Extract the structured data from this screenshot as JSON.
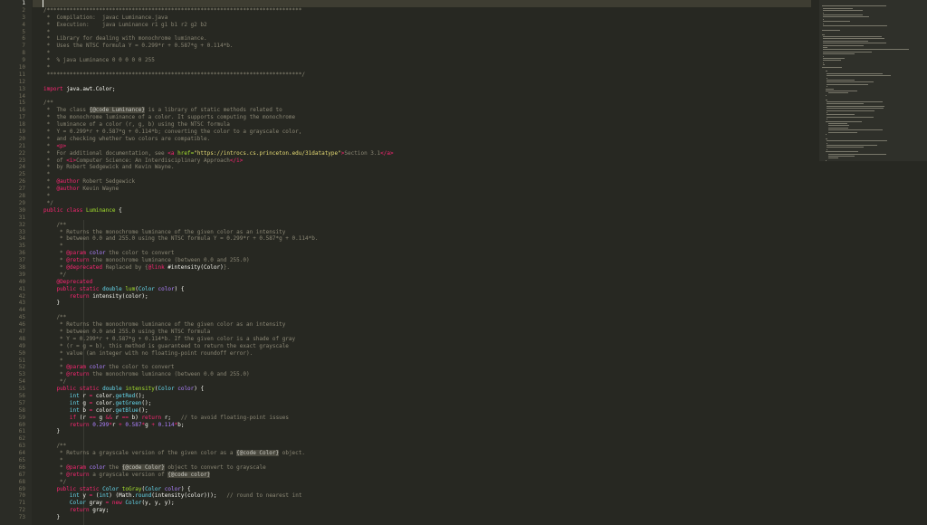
{
  "editor": {
    "current_line": 1,
    "line_numbers": [
      "1",
      "2",
      "3",
      "4",
      "5",
      "6",
      "7",
      "8",
      "9",
      "10",
      "11",
      "12",
      "13",
      "14",
      "15",
      "16",
      "17",
      "18",
      "19",
      "20",
      "21",
      "22",
      "23",
      "24",
      "25",
      "26",
      "27",
      "28",
      "29",
      "30",
      "31",
      "32",
      "33",
      "34",
      "35",
      "36",
      "37",
      "38",
      "39",
      "40",
      "41",
      "42",
      "43",
      "44",
      "45",
      "46",
      "47",
      "48",
      "49",
      "50",
      "51",
      "52",
      "53",
      "54",
      "55",
      "56",
      "57",
      "58",
      "59",
      "60",
      "61",
      "62",
      "63",
      "64",
      "65",
      "66",
      "67",
      "68",
      "69",
      "70",
      "71",
      "72",
      "73"
    ],
    "lines": [
      [],
      [
        [
          "c",
          "/******************************************************************************"
        ]
      ],
      [
        [
          "c",
          " *  Compilation:  javac Luminance.java"
        ]
      ],
      [
        [
          "c",
          " *  Execution:    java Luminance r1 g1 b1 r2 g2 b2"
        ]
      ],
      [
        [
          "c",
          " *"
        ]
      ],
      [
        [
          "c",
          " *  Library for dealing with monochrome luminance."
        ]
      ],
      [
        [
          "c",
          " *  Uses the NTSC formula Y = 0.299*r + 0.587*g + 0.114*b."
        ]
      ],
      [
        [
          "c",
          " *"
        ]
      ],
      [
        [
          "c",
          " *  % java Luminance 0 0 0 0 0 255"
        ]
      ],
      [
        [
          "c",
          " *"
        ]
      ],
      [
        [
          "c",
          " ******************************************************************************/"
        ]
      ],
      [],
      [
        [
          "k",
          "import"
        ],
        [
          "p",
          " java.awt.Color;"
        ]
      ],
      [],
      [
        [
          "c",
          "/**"
        ]
      ],
      [
        [
          "c",
          " *  The class "
        ],
        [
          "hl",
          "{@code Luminance}"
        ],
        [
          "c",
          " is a library of static methods related to"
        ]
      ],
      [
        [
          "c",
          " *  the monochrome luminance of a color. It supports computing the monochrome"
        ]
      ],
      [
        [
          "c",
          " *  luminance of a color (r, g, b) using the NTSC formula"
        ]
      ],
      [
        [
          "c",
          " *  Y = 0.299*r + 0.587*g + 0.114*b; converting the color to a grayscale color,"
        ]
      ],
      [
        [
          "c",
          " *  and checking whether two colors are compatible."
        ]
      ],
      [
        [
          "c",
          " *  "
        ],
        [
          "tag",
          "<p>"
        ]
      ],
      [
        [
          "c",
          " *  For additional documentation, see "
        ],
        [
          "tag",
          "<a"
        ],
        [
          "f",
          " href="
        ],
        [
          "s",
          "\"https://introcs.cs.princeton.edu/31datatype\""
        ],
        [
          "tag",
          ">"
        ],
        [
          "c",
          "Section 3.1"
        ],
        [
          "tag",
          "</a>"
        ]
      ],
      [
        [
          "c",
          " *  of "
        ],
        [
          "tag",
          "<i>"
        ],
        [
          "c",
          "Computer Science: An Interdisciplinary Approach"
        ],
        [
          "tag",
          "</i>"
        ]
      ],
      [
        [
          "c",
          " *  by Robert Sedgewick and Kevin Wayne."
        ]
      ],
      [
        [
          "c",
          " *"
        ]
      ],
      [
        [
          "c",
          " *  "
        ],
        [
          "k",
          "@author"
        ],
        [
          "c",
          " Robert Sedgewick"
        ]
      ],
      [
        [
          "c",
          " *  "
        ],
        [
          "k",
          "@author"
        ],
        [
          "c",
          " Kevin Wayne"
        ]
      ],
      [
        [
          "c",
          " *"
        ]
      ],
      [
        [
          "c",
          " */"
        ]
      ],
      [
        [
          "k",
          "public"
        ],
        [
          "p",
          " "
        ],
        [
          "k",
          "class"
        ],
        [
          "p",
          " "
        ],
        [
          "f",
          "Luminance"
        ],
        [
          "p",
          " {"
        ]
      ],
      [],
      [
        [
          "c",
          "    /**"
        ]
      ],
      [
        [
          "c",
          "     * Returns the monochrome luminance of the given color as an intensity"
        ]
      ],
      [
        [
          "c",
          "     * between 0.0 and 255.0 using the NTSC formula Y = 0.299*r + 0.587*g + 0.114*b."
        ]
      ],
      [
        [
          "c",
          "     *"
        ]
      ],
      [
        [
          "c",
          "     * "
        ],
        [
          "k",
          "@param"
        ],
        [
          "c",
          " "
        ],
        [
          "a",
          "color"
        ],
        [
          "c",
          " the color to convert"
        ]
      ],
      [
        [
          "c",
          "     * "
        ],
        [
          "k",
          "@return"
        ],
        [
          "c",
          " the monochrome luminance (between 0.0 and 255.0)"
        ]
      ],
      [
        [
          "c",
          "     * "
        ],
        [
          "k",
          "@deprecated"
        ],
        [
          "c",
          " Replaced by {"
        ],
        [
          "k",
          "@link"
        ],
        [
          "p",
          " #intensity(Color)"
        ],
        [
          "c",
          "}."
        ]
      ],
      [
        [
          "c",
          "     */"
        ]
      ],
      [
        [
          "p",
          "    "
        ],
        [
          "k",
          "@Deprecated"
        ]
      ],
      [
        [
          "p",
          "    "
        ],
        [
          "k",
          "public"
        ],
        [
          "p",
          " "
        ],
        [
          "k",
          "static"
        ],
        [
          "p",
          " "
        ],
        [
          "t",
          "double"
        ],
        [
          "p",
          " "
        ],
        [
          "f",
          "lum"
        ],
        [
          "p",
          "("
        ],
        [
          "t",
          "Color"
        ],
        [
          "p",
          " "
        ],
        [
          "a",
          "color"
        ],
        [
          "p",
          ") {"
        ]
      ],
      [
        [
          "p",
          "        "
        ],
        [
          "k",
          "return"
        ],
        [
          "p",
          " intensity(color);"
        ]
      ],
      [
        [
          "p",
          "    }"
        ]
      ],
      [],
      [
        [
          "c",
          "    /**"
        ]
      ],
      [
        [
          "c",
          "     * Returns the monochrome luminance of the given color as an intensity"
        ]
      ],
      [
        [
          "c",
          "     * between 0.0 and 255.0 using the NTSC formula"
        ]
      ],
      [
        [
          "c",
          "     * Y = 0.299*r + 0.587*g + 0.114*b. If the given color is a shade of gray"
        ]
      ],
      [
        [
          "c",
          "     * (r = g = b), this method is guaranteed to return the exact grayscale"
        ]
      ],
      [
        [
          "c",
          "     * value (an integer with no floating-point roundoff error)."
        ]
      ],
      [
        [
          "c",
          "     *"
        ]
      ],
      [
        [
          "c",
          "     * "
        ],
        [
          "k",
          "@param"
        ],
        [
          "c",
          " "
        ],
        [
          "a",
          "color"
        ],
        [
          "c",
          " the color to convert"
        ]
      ],
      [
        [
          "c",
          "     * "
        ],
        [
          "k",
          "@return"
        ],
        [
          "c",
          " the monochrome luminance (between 0.0 and 255.0)"
        ]
      ],
      [
        [
          "c",
          "     */"
        ]
      ],
      [
        [
          "p",
          "    "
        ],
        [
          "k",
          "public"
        ],
        [
          "p",
          " "
        ],
        [
          "k",
          "static"
        ],
        [
          "p",
          " "
        ],
        [
          "t",
          "double"
        ],
        [
          "p",
          " "
        ],
        [
          "f",
          "intensity"
        ],
        [
          "p",
          "("
        ],
        [
          "t",
          "Color"
        ],
        [
          "p",
          " "
        ],
        [
          "a",
          "color"
        ],
        [
          "p",
          ") {"
        ]
      ],
      [
        [
          "p",
          "        "
        ],
        [
          "t",
          "int"
        ],
        [
          "p",
          " r "
        ],
        [
          "k",
          "="
        ],
        [
          "p",
          " color."
        ],
        [
          "t",
          "getRed"
        ],
        [
          "p",
          "();"
        ]
      ],
      [
        [
          "p",
          "        "
        ],
        [
          "t",
          "int"
        ],
        [
          "p",
          " g "
        ],
        [
          "k",
          "="
        ],
        [
          "p",
          " color."
        ],
        [
          "t",
          "getGreen"
        ],
        [
          "p",
          "();"
        ]
      ],
      [
        [
          "p",
          "        "
        ],
        [
          "t",
          "int"
        ],
        [
          "p",
          " b "
        ],
        [
          "k",
          "="
        ],
        [
          "p",
          " color."
        ],
        [
          "t",
          "getBlue"
        ],
        [
          "p",
          "();"
        ]
      ],
      [
        [
          "p",
          "        "
        ],
        [
          "k",
          "if"
        ],
        [
          "p",
          " (r "
        ],
        [
          "k",
          "=="
        ],
        [
          "p",
          " g "
        ],
        [
          "k",
          "&&"
        ],
        [
          "p",
          " r "
        ],
        [
          "k",
          "=="
        ],
        [
          "p",
          " b) "
        ],
        [
          "k",
          "return"
        ],
        [
          "p",
          " r;   "
        ],
        [
          "c",
          "// to avoid floating-point issues"
        ]
      ],
      [
        [
          "p",
          "        "
        ],
        [
          "k",
          "return"
        ],
        [
          "p",
          " "
        ],
        [
          "n",
          "0.299"
        ],
        [
          "k",
          "*"
        ],
        [
          "p",
          "r "
        ],
        [
          "k",
          "+"
        ],
        [
          "p",
          " "
        ],
        [
          "n",
          "0.587"
        ],
        [
          "k",
          "*"
        ],
        [
          "p",
          "g "
        ],
        [
          "k",
          "+"
        ],
        [
          "p",
          " "
        ],
        [
          "n",
          "0.114"
        ],
        [
          "k",
          "*"
        ],
        [
          "p",
          "b;"
        ]
      ],
      [
        [
          "p",
          "    }"
        ]
      ],
      [],
      [
        [
          "c",
          "    /**"
        ]
      ],
      [
        [
          "c",
          "     * Returns a grayscale version of the given color as a "
        ],
        [
          "hl",
          "{@code Color}"
        ],
        [
          "c",
          " object."
        ]
      ],
      [
        [
          "c",
          "     *"
        ]
      ],
      [
        [
          "c",
          "     * "
        ],
        [
          "k",
          "@param"
        ],
        [
          "c",
          " "
        ],
        [
          "a",
          "color"
        ],
        [
          "c",
          " the "
        ],
        [
          "hl",
          "{@code Color}"
        ],
        [
          "c",
          " object to convert to grayscale"
        ]
      ],
      [
        [
          "c",
          "     * "
        ],
        [
          "k",
          "@return"
        ],
        [
          "c",
          " a grayscale version of "
        ],
        [
          "hl",
          "{@code color}"
        ]
      ],
      [
        [
          "c",
          "     */"
        ]
      ],
      [
        [
          "p",
          "    "
        ],
        [
          "k",
          "public"
        ],
        [
          "p",
          " "
        ],
        [
          "k",
          "static"
        ],
        [
          "p",
          " "
        ],
        [
          "t",
          "Color"
        ],
        [
          "p",
          " "
        ],
        [
          "f",
          "toGray"
        ],
        [
          "p",
          "("
        ],
        [
          "t",
          "Color"
        ],
        [
          "p",
          " "
        ],
        [
          "a",
          "color"
        ],
        [
          "p",
          ") {"
        ]
      ],
      [
        [
          "p",
          "        "
        ],
        [
          "t",
          "int"
        ],
        [
          "p",
          " y "
        ],
        [
          "k",
          "="
        ],
        [
          "p",
          " ("
        ],
        [
          "t",
          "int"
        ],
        [
          "p",
          ") (Math."
        ],
        [
          "t",
          "round"
        ],
        [
          "p",
          "(intensity(color)));   "
        ],
        [
          "c",
          "// round to nearest int"
        ]
      ],
      [
        [
          "p",
          "        "
        ],
        [
          "t",
          "Color"
        ],
        [
          "p",
          " gray "
        ],
        [
          "k",
          "="
        ],
        [
          "p",
          " "
        ],
        [
          "k",
          "new"
        ],
        [
          "p",
          " "
        ],
        [
          "t",
          "Color"
        ],
        [
          "p",
          "(y, y, y);"
        ]
      ],
      [
        [
          "p",
          "        "
        ],
        [
          "k",
          "return"
        ],
        [
          "p",
          " gray;"
        ]
      ],
      [
        [
          "p",
          "    }"
        ]
      ]
    ]
  }
}
